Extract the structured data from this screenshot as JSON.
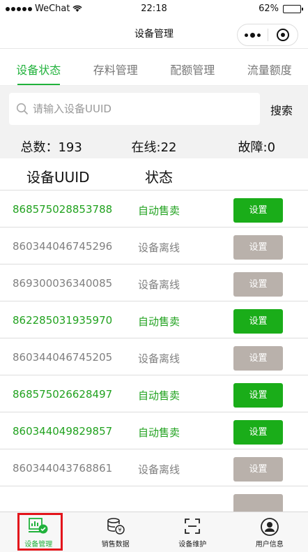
{
  "status_bar": {
    "carrier": "WeChat",
    "time": "22:18",
    "battery": "62%",
    "battery_level": 0.62
  },
  "nav": {
    "title": "设备管理"
  },
  "tabs": [
    {
      "label": "设备状态",
      "active": true
    },
    {
      "label": "存料管理",
      "active": false
    },
    {
      "label": "配额管理",
      "active": false
    },
    {
      "label": "流量额度",
      "active": false
    }
  ],
  "search": {
    "placeholder": "请输入设备UUID",
    "button": "搜索"
  },
  "summary": {
    "total": "总数：193",
    "online": "在线:22",
    "fault": "故障:0"
  },
  "table": {
    "col_uuid": "设备UUID",
    "col_status": "状态",
    "rows": [
      {
        "uuid": "868575028853788",
        "status": "自动售卖",
        "online": true,
        "action": "设置"
      },
      {
        "uuid": "860344046745296",
        "status": "设备离线",
        "online": false,
        "action": "设置"
      },
      {
        "uuid": "869300036340085",
        "status": "设备离线",
        "online": false,
        "action": "设置"
      },
      {
        "uuid": "862285031935970",
        "status": "自动售卖",
        "online": true,
        "action": "设置"
      },
      {
        "uuid": "860344046745205",
        "status": "设备离线",
        "online": false,
        "action": "设置"
      },
      {
        "uuid": "868575026628497",
        "status": "自动售卖",
        "online": true,
        "action": "设置"
      },
      {
        "uuid": "860344049829857",
        "status": "自动售卖",
        "online": true,
        "action": "设置"
      },
      {
        "uuid": "860344043768861",
        "status": "设备离线",
        "online": false,
        "action": "设置"
      }
    ]
  },
  "tabbar": [
    {
      "label": "设备管理",
      "icon": "device-manage-icon",
      "active": true
    },
    {
      "label": "销售数据",
      "icon": "sales-data-icon",
      "active": false
    },
    {
      "label": "设备维护",
      "icon": "device-maintenance-icon",
      "active": false
    },
    {
      "label": "用户信息",
      "icon": "user-info-icon",
      "active": false
    }
  ],
  "colors": {
    "accent": "#21b23c",
    "online_button": "#1aad19",
    "offline_button": "#b9b1ab",
    "highlight": "#e3141b"
  }
}
